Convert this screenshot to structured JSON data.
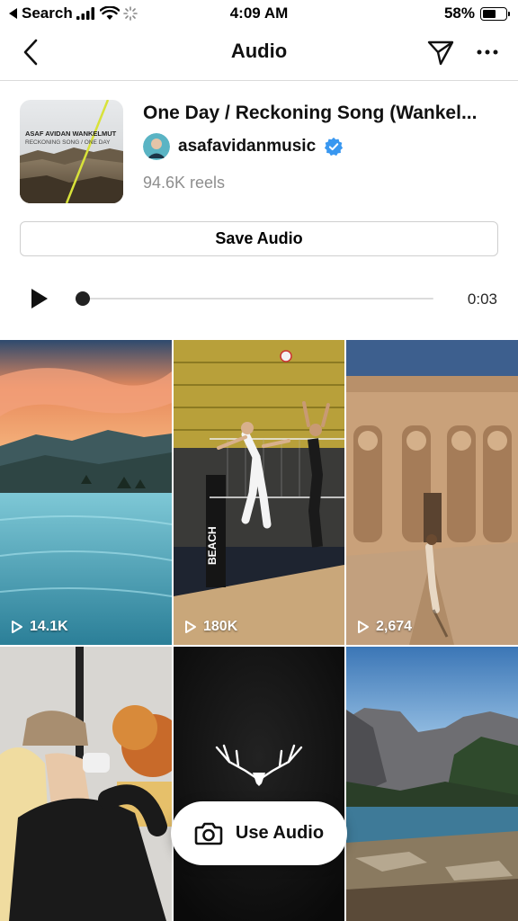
{
  "status_bar": {
    "back_app": "Search",
    "time": "4:09 AM",
    "battery": "58%",
    "battery_level": 0.58
  },
  "nav": {
    "title": "Audio",
    "icons": [
      "back-chevron-icon",
      "share-direct-icon",
      "more-options-icon"
    ]
  },
  "audio": {
    "title": "One Day / Reckoning Song (Wankel...",
    "artist": "asafavidanmusic",
    "verified": true,
    "reels": "94.6K reels",
    "album_art_text": {
      "line1": "ASAF AVIDAN   WANKELMUT",
      "line2": "RECKONING SONG / ONE DAY"
    }
  },
  "actions": {
    "save_label": "Save Audio",
    "use_label": "Use Audio"
  },
  "player": {
    "time": "0:03",
    "progress": 0.0
  },
  "reels": [
    {
      "views": "14.1K",
      "scene": "infinity-pool-sunset"
    },
    {
      "views": "180K",
      "scene": "volleyball-spike"
    },
    {
      "views": "2,674",
      "scene": "abu-simbel-temple"
    },
    {
      "views": "",
      "scene": "woman-drinking-coffee"
    },
    {
      "views": "",
      "scene": "dark-antler-logo"
    },
    {
      "views": "",
      "scene": "mountain-lake"
    }
  ],
  "colors": {
    "verified_blue": "#3897f0",
    "text_primary": "#111111",
    "text_secondary": "#8e8e8e"
  }
}
